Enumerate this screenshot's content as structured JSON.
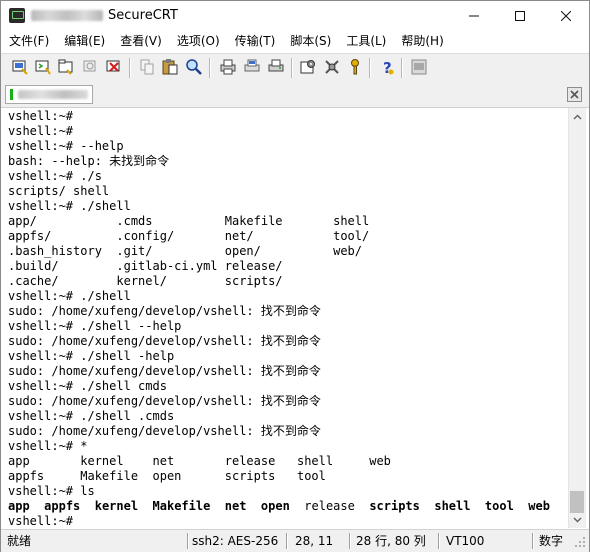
{
  "window": {
    "title": "SecureCRT",
    "colors": {
      "titlebar": "#ffffff",
      "chrome": "#f0f0f0",
      "terminal_bg": "#ffffff",
      "session_active": "#12b312"
    }
  },
  "menu": [
    "文件(F)",
    "编辑(E)",
    "查看(V)",
    "选项(O)",
    "传输(T)",
    "脚本(S)",
    "工具(L)",
    "帮助(H)"
  ],
  "toolbar": {
    "buttons": [
      "connect-icon",
      "quick-connect-icon",
      "connect-in-tab-icon",
      "reconnect-icon",
      "disconnect-icon",
      "copy-icon",
      "paste-icon",
      "find-icon",
      "print-icon",
      "print-selection-icon",
      "print-screen-icon",
      "session-options-icon",
      "global-options-icon",
      "keymap-icon",
      "help-icon",
      "sftp-icon"
    ]
  },
  "session_tab": {
    "close_label": "×"
  },
  "terminal": {
    "lines": [
      "vshell:~#",
      "vshell:~#",
      "vshell:~# --help",
      "bash: --help: 未找到命令",
      "vshell:~# ./s",
      "scripts/ shell",
      "vshell:~# ./shell",
      "app/           .cmds          Makefile       shell",
      "appfs/         .config/       net/           tool/",
      ".bash_history  .git/          open/          web/",
      ".build/        .gitlab-ci.yml release/",
      ".cache/        kernel/        scripts/",
      "vshell:~# ./shell",
      "sudo: /home/xufeng/develop/vshell: 找不到命令",
      "vshell:~# ./shell --help",
      "sudo: /home/xufeng/develop/vshell: 找不到命令",
      "vshell:~# ./shell -help",
      "sudo: /home/xufeng/develop/vshell: 找不到命令",
      "vshell:~# ./shell cmds",
      "sudo: /home/xufeng/develop/vshell: 找不到命令",
      "vshell:~# ./shell .cmds",
      "sudo: /home/xufeng/develop/vshell: 找不到命令",
      "vshell:~# *",
      "app       kernel    net       release   shell     web",
      "appfs     Makefile  open      scripts   tool",
      "vshell:~# ls"
    ],
    "ls_output": [
      {
        "text": "app",
        "bold": true
      },
      {
        "text": "appfs",
        "bold": true
      },
      {
        "text": "kernel",
        "bold": true
      },
      {
        "text": "Makefile",
        "bold": true
      },
      {
        "text": "net",
        "bold": true
      },
      {
        "text": "open",
        "bold": true
      },
      {
        "text": "release",
        "bold": false
      },
      {
        "text": "scripts",
        "bold": true
      },
      {
        "text": "shell",
        "bold": true
      },
      {
        "text": "tool",
        "bold": true
      },
      {
        "text": "web",
        "bold": true
      }
    ],
    "prompt": "vshell:~#"
  },
  "statusbar": {
    "ready": "就绪",
    "cipher": "ssh2: AES-256",
    "cursor": "28,  11",
    "size": "28 行,  80 列",
    "emulation": "VT100",
    "mode": "数字"
  }
}
